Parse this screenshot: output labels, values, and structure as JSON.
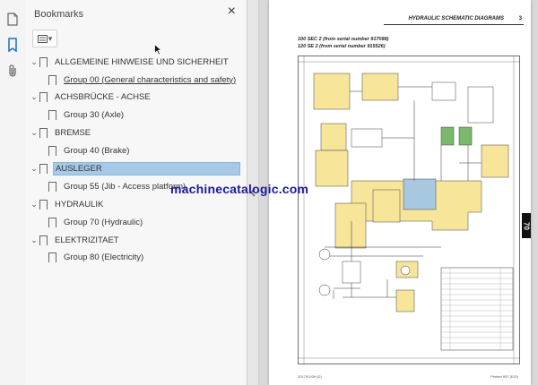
{
  "toolbar_rail": {
    "icons": [
      "page-thumbnails-icon",
      "bookmark-icon",
      "attachment-icon"
    ]
  },
  "bookmarks_panel": {
    "title": "Bookmarks",
    "close_label": "×",
    "items": [
      {
        "level": 0,
        "label": "ALLGEMEINE HINWEISE UND SICHERHEIT",
        "expanded": true,
        "selected": false
      },
      {
        "level": 1,
        "label": "Group 00 (General characteristics and safety)",
        "selected": false,
        "underlined": true
      },
      {
        "level": 0,
        "label": "ACHSBRÜCKE - ACHSE",
        "expanded": true,
        "selected": false
      },
      {
        "level": 1,
        "label": "Group 30 (Axle)",
        "selected": false
      },
      {
        "level": 0,
        "label": "BREMSE",
        "expanded": true,
        "selected": false
      },
      {
        "level": 1,
        "label": "Group 40 (Brake)",
        "selected": false
      },
      {
        "level": 0,
        "label": "AUSLEGER",
        "expanded": true,
        "selected": true
      },
      {
        "level": 1,
        "label": "Group 55 (Jib - Access platform)",
        "selected": false
      },
      {
        "level": 0,
        "label": "HYDRAULIK",
        "expanded": true,
        "selected": false
      },
      {
        "level": 1,
        "label": "Group 70 (Hydraulic)",
        "selected": false
      },
      {
        "level": 0,
        "label": "ELEKTRIZITAET",
        "expanded": true,
        "selected": false
      },
      {
        "level": 1,
        "label": "Group 80 (Electricity)",
        "selected": false
      }
    ]
  },
  "document": {
    "header_title": "HYDRAULIC SCHEMATIC DIAGRAMS",
    "page_number": "3",
    "subtitle_1": "100 SEC 2 (from serial number 917098)",
    "subtitle_2": "120 SE 2 (from serial number 915526)",
    "watermark": "machinecatalogic.com",
    "side_tab": "70",
    "footer_left": "2017/01/09 (D)",
    "footer_right": "Printed 957 (E/D)",
    "colors": {
      "diagram_fill": "#f7e59a",
      "valve_fill": "#a8c8e0",
      "line": "#333333",
      "green": "#7ab86a"
    }
  }
}
